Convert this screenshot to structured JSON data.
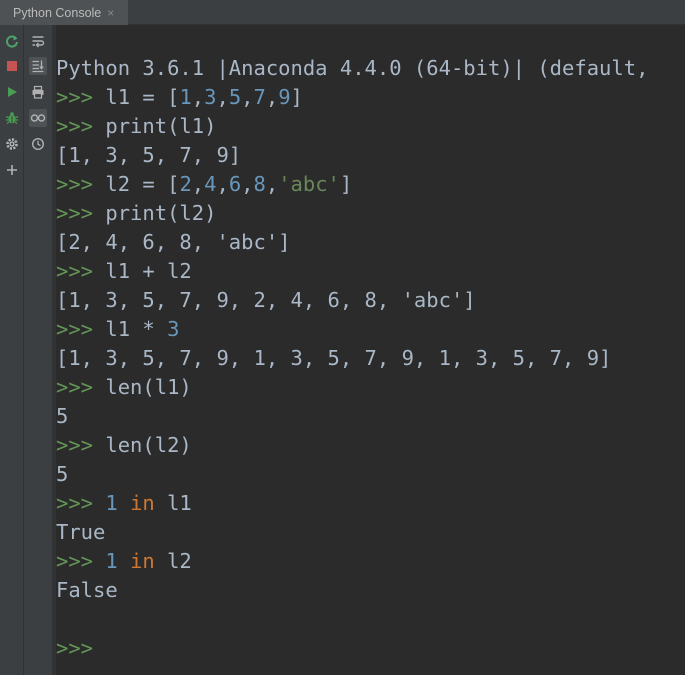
{
  "tab": {
    "title": "Python Console",
    "close_glyph": "×"
  },
  "toolbar_left": [
    {
      "icon": "rerun-icon",
      "color": "#4ea36a"
    },
    {
      "icon": "stop-icon",
      "color": "#c75450"
    },
    {
      "icon": "run-icon",
      "color": "#499c54"
    },
    {
      "icon": "debug-icon",
      "color": "#499c54"
    },
    {
      "icon": "settings-icon",
      "color": "#afb1b3"
    },
    {
      "icon": "add-icon",
      "color": "#afb1b3"
    }
  ],
  "toolbar_right": [
    {
      "icon": "soft-wrap-icon"
    },
    {
      "icon": "scroll-to-end-icon",
      "selected": true
    },
    {
      "icon": "print-icon"
    },
    {
      "icon": "show-variables-icon",
      "selected": true
    },
    {
      "icon": "history-icon"
    }
  ],
  "console": {
    "prompt": ">>>",
    "lines": [
      {
        "type": "output",
        "text": "Python 3.6.1 |Anaconda 4.4.0 (64-bit)| (default, "
      },
      {
        "type": "input",
        "tokens": [
          {
            "t": "l1 = [",
            "c": ""
          },
          {
            "t": "1",
            "c": "num"
          },
          {
            "t": ",",
            "c": ""
          },
          {
            "t": "3",
            "c": "num"
          },
          {
            "t": ",",
            "c": ""
          },
          {
            "t": "5",
            "c": "num"
          },
          {
            "t": ",",
            "c": ""
          },
          {
            "t": "7",
            "c": "num"
          },
          {
            "t": ",",
            "c": ""
          },
          {
            "t": "9",
            "c": "num"
          },
          {
            "t": "]",
            "c": ""
          }
        ]
      },
      {
        "type": "input",
        "tokens": [
          {
            "t": "print(l1)",
            "c": ""
          }
        ]
      },
      {
        "type": "output",
        "text": "[1, 3, 5, 7, 9]"
      },
      {
        "type": "input",
        "tokens": [
          {
            "t": "l2 = [",
            "c": ""
          },
          {
            "t": "2",
            "c": "num"
          },
          {
            "t": ",",
            "c": ""
          },
          {
            "t": "4",
            "c": "num"
          },
          {
            "t": ",",
            "c": ""
          },
          {
            "t": "6",
            "c": "num"
          },
          {
            "t": ",",
            "c": ""
          },
          {
            "t": "8",
            "c": "num"
          },
          {
            "t": ",",
            "c": ""
          },
          {
            "t": "'abc'",
            "c": "str"
          },
          {
            "t": "]",
            "c": ""
          }
        ]
      },
      {
        "type": "input",
        "tokens": [
          {
            "t": "print(l2)",
            "c": ""
          }
        ]
      },
      {
        "type": "output",
        "text": "[2, 4, 6, 8, 'abc']"
      },
      {
        "type": "input",
        "tokens": [
          {
            "t": "l1 + l2",
            "c": ""
          }
        ]
      },
      {
        "type": "output",
        "text": "[1, 3, 5, 7, 9, 2, 4, 6, 8, 'abc']"
      },
      {
        "type": "input",
        "tokens": [
          {
            "t": "l1 * ",
            "c": ""
          },
          {
            "t": "3",
            "c": "num"
          }
        ]
      },
      {
        "type": "output",
        "text": "[1, 3, 5, 7, 9, 1, 3, 5, 7, 9, 1, 3, 5, 7, 9]"
      },
      {
        "type": "input",
        "tokens": [
          {
            "t": "len(l1)",
            "c": ""
          }
        ]
      },
      {
        "type": "output",
        "text": "5"
      },
      {
        "type": "input",
        "tokens": [
          {
            "t": "len(l2)",
            "c": ""
          }
        ]
      },
      {
        "type": "output",
        "text": "5"
      },
      {
        "type": "input",
        "tokens": [
          {
            "t": "1",
            "c": "num"
          },
          {
            "t": " ",
            "c": ""
          },
          {
            "t": "in",
            "c": "kw"
          },
          {
            "t": " l1",
            "c": ""
          }
        ]
      },
      {
        "type": "output",
        "text": "True"
      },
      {
        "type": "input",
        "tokens": [
          {
            "t": "1",
            "c": "num"
          },
          {
            "t": " ",
            "c": ""
          },
          {
            "t": "in",
            "c": "kw"
          },
          {
            "t": " l2",
            "c": ""
          }
        ]
      },
      {
        "type": "output",
        "text": "False"
      },
      {
        "type": "output",
        "text": ""
      },
      {
        "type": "prompt-only",
        "tokens": []
      }
    ]
  }
}
